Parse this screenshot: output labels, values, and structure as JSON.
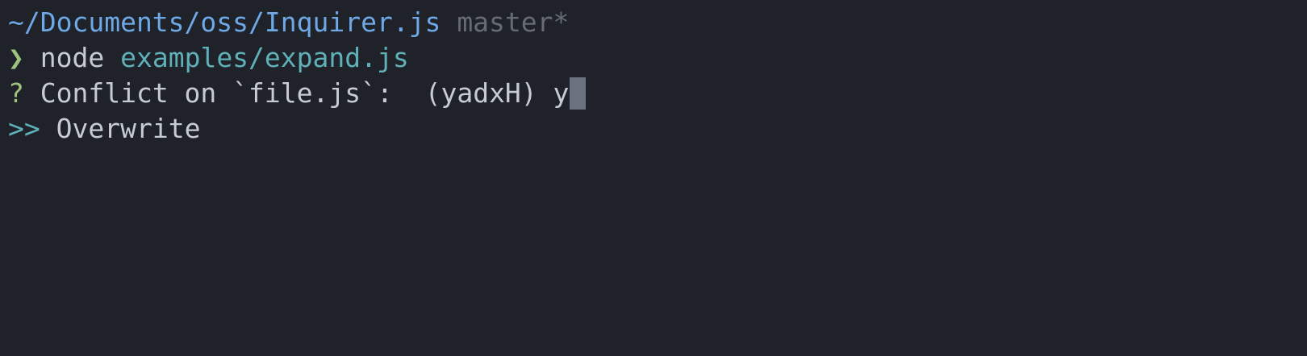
{
  "terminal": {
    "path": "~/Documents/oss/Inquirer.js",
    "branch": "master*",
    "prompt_symbol": "❯",
    "command": "node",
    "argument": "examples/expand.js",
    "question_mark": "?",
    "question": "Conflict on `file.js`:",
    "hint": "(yadxH)",
    "answer": "y",
    "pointer": ">>",
    "selected_option": "Overwrite"
  },
  "colors": {
    "background": "#1f2228",
    "path": "#6ea8e6",
    "branch": "#666b75",
    "prompt_symbol": "#9fc27f",
    "argument": "#5fb0b8",
    "text": "#c7ccd4",
    "cursor": "#6b7280"
  }
}
